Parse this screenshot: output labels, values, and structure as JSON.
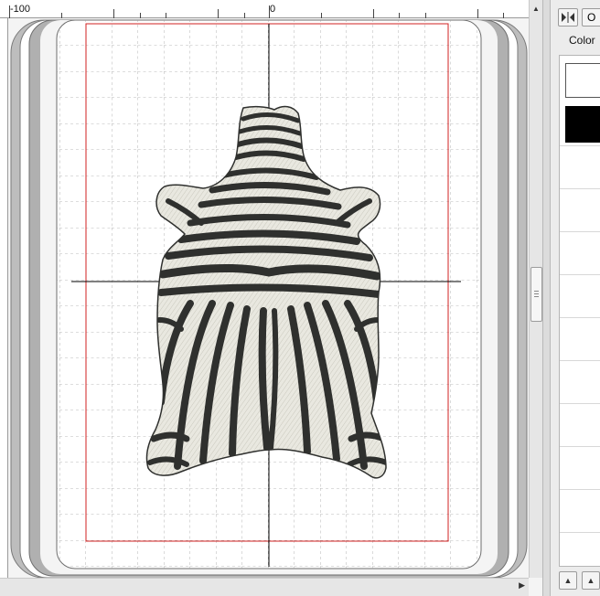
{
  "ruler": {
    "labels": [
      "-100",
      "0"
    ]
  },
  "panel": {
    "ok_label": "O",
    "color_label": "Color",
    "swatches": [
      "#ffffff",
      "#000000"
    ]
  },
  "design": {
    "name": "zebra-hide-embroidery",
    "stripe_color": "#2f302e",
    "base_color": "#e9e8e0"
  },
  "colors": {
    "hoop_frame": "#b9b9b9",
    "hoop_inner": "#d0d0d0",
    "grid_line": "#9a9a9a",
    "safe_area_border": "#d22020",
    "crosshair": "#000000"
  }
}
